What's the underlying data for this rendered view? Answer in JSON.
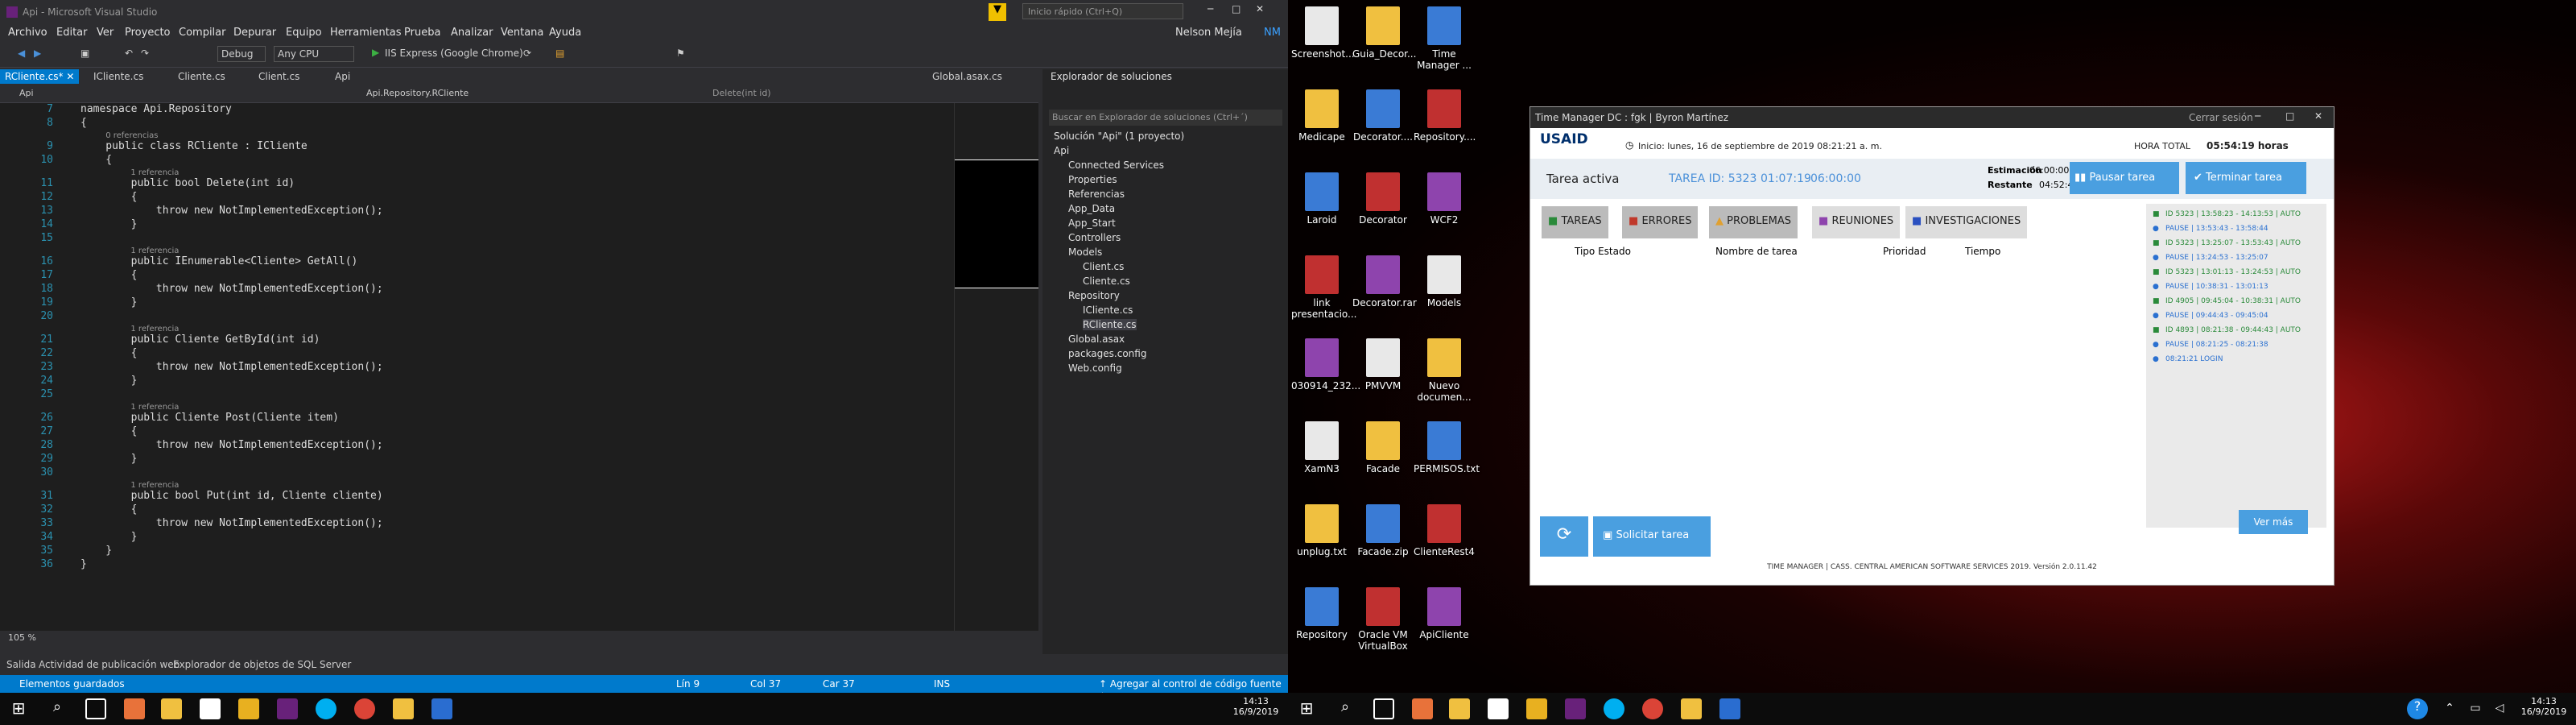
{
  "vs": {
    "title": "Api - Microsoft Visual Studio",
    "quick_launch": "Inicio rápido (Ctrl+Q)",
    "user": "Nelson Mejía",
    "user_initials": "NM",
    "menu": [
      "Archivo",
      "Editar",
      "Ver",
      "Proyecto",
      "Compilar",
      "Depurar",
      "Equipo",
      "Herramientas",
      "Prueba",
      "Analizar",
      "Ventana",
      "Ayuda"
    ],
    "toolbar": {
      "config": "Debug",
      "platform": "Any CPU",
      "run": "IIS Express (Google Chrome)"
    },
    "tabs": [
      "RCliente.cs*",
      "ICliente.cs",
      "Cliente.cs",
      "Client.cs",
      "Api",
      "Global.asax.cs"
    ],
    "nav": {
      "project": "Api",
      "class": "Api.Repository.RCliente",
      "member": "Delete(int id)"
    },
    "code": [
      {
        "n": "7",
        "t": "namespace Api.Repository"
      },
      {
        "n": "8",
        "t": "{"
      },
      {
        "n": "9",
        "t": "    public class RCliente : ICliente",
        "ref": "0 referencias"
      },
      {
        "n": "10",
        "t": "    {"
      },
      {
        "n": "11",
        "t": "        public bool Delete(int id)",
        "ref": "1 referencia"
      },
      {
        "n": "12",
        "t": "        {"
      },
      {
        "n": "13",
        "t": "            throw new NotImplementedException();"
      },
      {
        "n": "14",
        "t": "        }"
      },
      {
        "n": "15",
        "t": ""
      },
      {
        "n": "16",
        "t": "        public IEnumerable<Cliente> GetAll()",
        "ref": "1 referencia"
      },
      {
        "n": "17",
        "t": "        {"
      },
      {
        "n": "18",
        "t": "            throw new NotImplementedException();"
      },
      {
        "n": "19",
        "t": "        }"
      },
      {
        "n": "20",
        "t": ""
      },
      {
        "n": "21",
        "t": "        public Cliente GetById(int id)",
        "ref": "1 referencia"
      },
      {
        "n": "22",
        "t": "        {"
      },
      {
        "n": "23",
        "t": "            throw new NotImplementedException();"
      },
      {
        "n": "24",
        "t": "        }"
      },
      {
        "n": "25",
        "t": ""
      },
      {
        "n": "26",
        "t": "        public Cliente Post(Cliente item)",
        "ref": "1 referencia"
      },
      {
        "n": "27",
        "t": "        {"
      },
      {
        "n": "28",
        "t": "            throw new NotImplementedException();"
      },
      {
        "n": "29",
        "t": "        }"
      },
      {
        "n": "30",
        "t": ""
      },
      {
        "n": "31",
        "t": "        public bool Put(int id, Cliente cliente)",
        "ref": "1 referencia"
      },
      {
        "n": "32",
        "t": "        {"
      },
      {
        "n": "33",
        "t": "            throw new NotImplementedException();"
      },
      {
        "n": "34",
        "t": "        }"
      },
      {
        "n": "35",
        "t": "    }"
      },
      {
        "n": "36",
        "t": "}"
      }
    ],
    "zoom": "105 %",
    "solution_explorer": {
      "title": "Explorador de soluciones",
      "search": "Buscar en Explorador de soluciones (Ctrl+´)",
      "items": [
        {
          "label": "Solución \"Api\" (1 proyecto)",
          "lvl": 0
        },
        {
          "label": "Api",
          "lvl": 0
        },
        {
          "label": "Connected Services",
          "lvl": 1
        },
        {
          "label": "Properties",
          "lvl": 1
        },
        {
          "label": "Referencias",
          "lvl": 1
        },
        {
          "label": "App_Data",
          "lvl": 1
        },
        {
          "label": "App_Start",
          "lvl": 1
        },
        {
          "label": "Controllers",
          "lvl": 1
        },
        {
          "label": "Models",
          "lvl": 1
        },
        {
          "label": "Client.cs",
          "lvl": 2
        },
        {
          "label": "Cliente.cs",
          "lvl": 2
        },
        {
          "label": "Repository",
          "lvl": 1
        },
        {
          "label": "ICliente.cs",
          "lvl": 2
        },
        {
          "label": "RCliente.cs",
          "lvl": 2
        },
        {
          "label": "Global.asax",
          "lvl": 1
        },
        {
          "label": "packages.config",
          "lvl": 1
        },
        {
          "label": "Web.config",
          "lvl": 1
        }
      ]
    },
    "bottom_tabs": [
      "Salida",
      "Actividad de publicación web",
      "Explorador de objetos de SQL Server"
    ],
    "status": {
      "left": "Elementos guardados",
      "line": "Lín 9",
      "col": "Col 37",
      "car": "Car 37",
      "ins": "INS",
      "source": "Agregar al control de código fuente"
    }
  },
  "taskbar": {
    "time": "14:13",
    "date": "16/9/2019"
  },
  "desktop": [
    [
      "Screenshot...",
      "Guia_Decor...",
      "Time Manager ..."
    ],
    [
      "Medicape",
      "Decorator....",
      "Repository...."
    ],
    [
      "Laroid",
      "Decorator",
      "WCF2"
    ],
    [
      "link presentacio...",
      "Decorator.rar",
      "Models"
    ],
    [
      "030914_232...",
      "PMVVM",
      "Nuevo documen..."
    ],
    [
      "XamN3",
      "Facade",
      "PERMISOS.txt"
    ],
    [
      "unplug.txt",
      "Facade.zip",
      "ClienteRest4"
    ],
    [
      "Repository",
      "Oracle VM VirtualBox",
      "ApiCliente"
    ]
  ],
  "tm": {
    "title": "Time Manager DC : fgk | Byron Martínez",
    "logout": "Cerrar sesión",
    "logo": "USAID",
    "start": "Inicio: lunes, 16 de septiembre de 2019 08:21:21 a. m.",
    "total_label": "HORA TOTAL",
    "total": "05:54:19 horas",
    "active_label": "Tarea activa",
    "task_id": "TAREA ID: 5323",
    "task_time": "01:07:19",
    "task_total": "06:00:00",
    "estimacion_label": "Estimación",
    "estimacion": "06:00:00",
    "restante_label": "Restante",
    "restante": "04:52:40",
    "pause_btn": "Pausar tarea",
    "finish_btn": "Terminar tarea",
    "tabs": [
      "TAREAS",
      "ERRORES",
      "PROBLEMAS",
      "REUNIONES",
      "INVESTIGACIONES"
    ],
    "columns": [
      "Tipo Estado",
      "Nombre de tarea",
      "Prioridad",
      "Tiempo"
    ],
    "log": [
      "ID 5323 | 13:58:23 - 14:13:53 | AUTO",
      "PAUSE | 13:53:43 - 13:58:44",
      "ID 5323 | 13:25:07 - 13:53:43 | AUTO",
      "PAUSE | 13:24:53 - 13:25:07",
      "ID 5323 | 13:01:13 - 13:24:53 | AUTO",
      "PAUSE | 10:38:31 - 13:01:13",
      "ID 4905 | 09:45:04 - 10:38:31 | AUTO",
      "PAUSE | 09:44:43 - 09:45:04",
      "ID 4893 | 08:21:38 - 09:44:43 | AUTO",
      "PAUSE | 08:21:25 - 08:21:38",
      "08:21:21 LOGIN"
    ],
    "request_btn": "Solicitar tarea",
    "more_btn": "Ver más",
    "footer": "TIME MANAGER | CASS. CENTRAL AMERICAN SOFTWARE SERVICES 2019. Versión 2.0.11.42"
  }
}
